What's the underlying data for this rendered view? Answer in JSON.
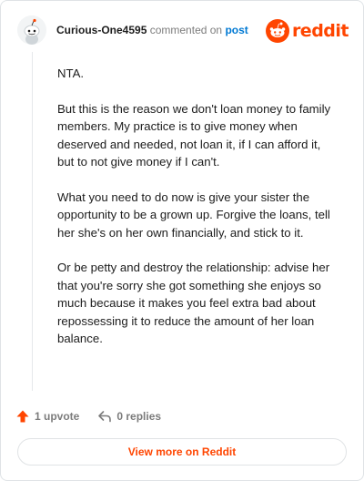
{
  "comment": {
    "author": "Curious-One4595",
    "action_text": "commented on",
    "post_link": "post",
    "paragraphs": [
      "NTA.",
      "But this is the reason we don't loan money to family members. My practice is to give money when deserved and needed, not loan it, if I can afford it, but to not give money if I can't.",
      "What you need to do now is give your sister the opportunity to be a grown up. Forgive the loans, tell her she's on her own financially, and stick to it.",
      "Or be petty and destroy the relationship: advise her that you're sorry she got something she enjoys so much because it makes you feel extra bad about repossessing it to reduce the amount of her loan balance."
    ]
  },
  "brand": {
    "wordmark": "reddit",
    "color": "#ff4500"
  },
  "actions": {
    "upvote_label": "1 upvote",
    "replies_label": "0 replies"
  },
  "footer": {
    "view_more_label": "View more on Reddit"
  },
  "icons": {
    "avatar": "snoo-avatar-icon",
    "logo": "reddit-logo-icon",
    "upvote": "upvote-arrow-icon",
    "reply": "reply-arrow-icon"
  }
}
